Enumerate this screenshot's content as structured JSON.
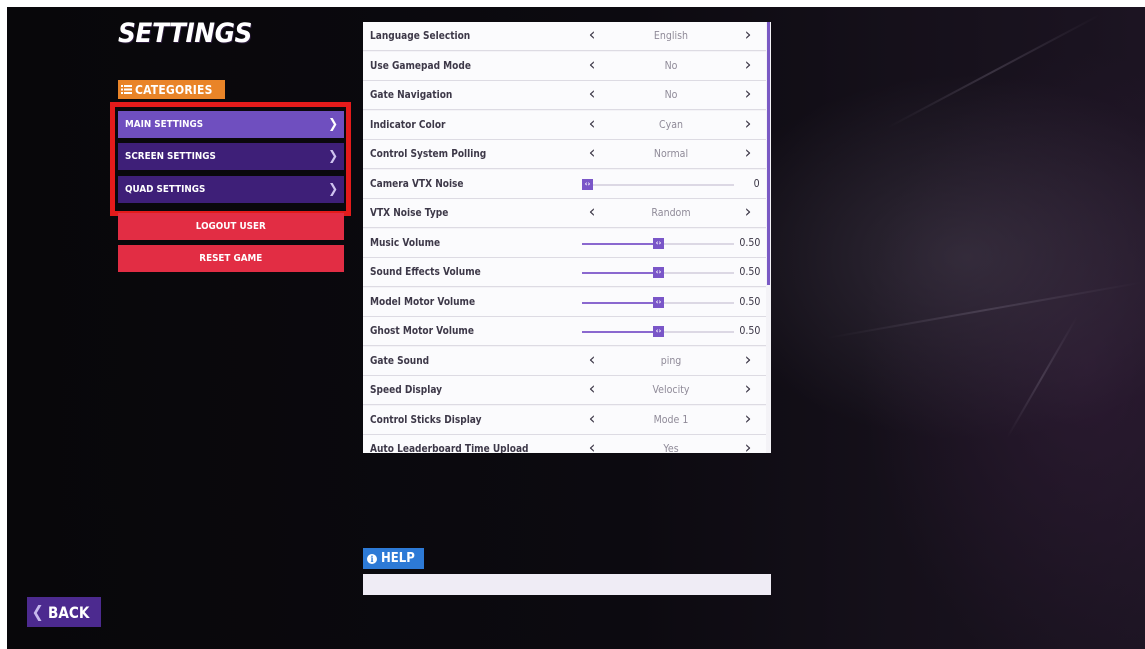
{
  "title": "SETTINGS",
  "categories": {
    "label": "CATEGORIES",
    "items": [
      {
        "label": "MAIN SETTINGS",
        "active": true
      },
      {
        "label": "SCREEN SETTINGS",
        "active": false
      },
      {
        "label": "QUAD SETTINGS",
        "active": false
      }
    ]
  },
  "actions": {
    "logout_label": "LOGOUT USER",
    "reset_label": "RESET GAME"
  },
  "settings": [
    {
      "label": "Language Selection",
      "type": "select",
      "value": "English"
    },
    {
      "label": "Use Gamepad Mode",
      "type": "select",
      "value": "No"
    },
    {
      "label": "Gate Navigation",
      "type": "select",
      "value": "No"
    },
    {
      "label": "Indicator Color",
      "type": "select",
      "value": "Cyan"
    },
    {
      "label": "Control System Polling",
      "type": "select",
      "value": "Normal"
    },
    {
      "label": "Camera VTX Noise",
      "type": "slider",
      "value": "0",
      "level": 0
    },
    {
      "label": "VTX Noise Type",
      "type": "select",
      "value": "Random"
    },
    {
      "label": "Music Volume",
      "type": "slider",
      "value": "0.50",
      "level": 0.5
    },
    {
      "label": "Sound Effects Volume",
      "type": "slider",
      "value": "0.50",
      "level": 0.5
    },
    {
      "label": "Model Motor Volume",
      "type": "slider",
      "value": "0.50",
      "level": 0.5
    },
    {
      "label": "Ghost Motor Volume",
      "type": "slider",
      "value": "0.50",
      "level": 0.5
    },
    {
      "label": "Gate Sound",
      "type": "select",
      "value": "ping"
    },
    {
      "label": "Speed Display",
      "type": "select",
      "value": "Velocity"
    },
    {
      "label": "Control Sticks Display",
      "type": "select",
      "value": "Mode 1"
    },
    {
      "label": "Auto Leaderboard Time Upload",
      "type": "select",
      "value": "Yes"
    }
  ],
  "help": {
    "label": "HELP",
    "text": ""
  },
  "back_label": "BACK",
  "colors": {
    "accent_purple": "#6f4fbf",
    "category_purple": "#3e1f78",
    "danger_red": "#e22d44",
    "categories_orange": "#e98428",
    "help_blue": "#2d7ad6",
    "highlight_red": "#e41b1b"
  },
  "icons": {
    "categories": "list-icon",
    "category_arrow": "chevron-right-icon",
    "prev": "chevron-left-icon",
    "next": "chevron-right-icon",
    "slider_knob": "slider-handle-icon",
    "help": "info-icon",
    "back": "chevron-left-icon"
  }
}
